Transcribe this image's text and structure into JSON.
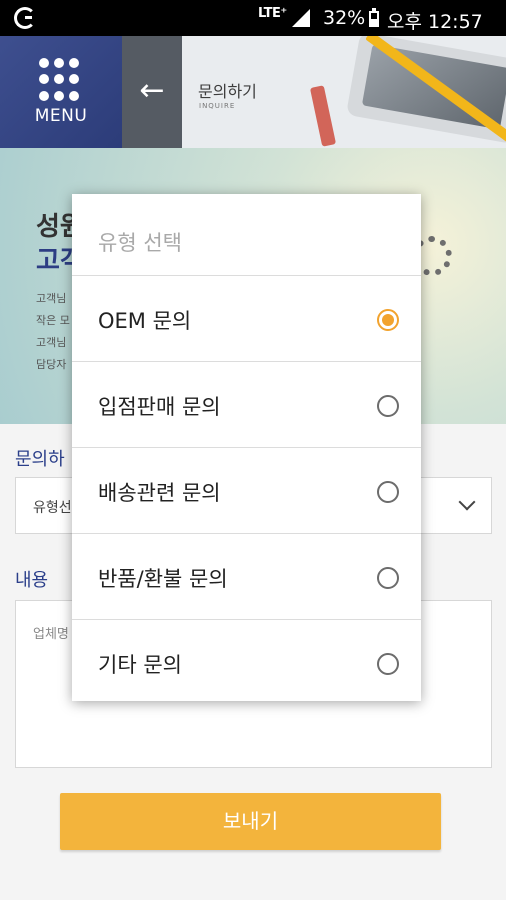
{
  "status_bar": {
    "network": "LTE⁺",
    "battery": "32%",
    "time": "오후 12:57"
  },
  "header": {
    "menu_label": "MENU",
    "back_icon": "arrow-left-icon",
    "title": "문의하기",
    "subtitle": "INQUIRE"
  },
  "banner": {
    "title_line1": "성원",
    "title_line2": "고객",
    "lines": [
      "고객님",
      "작은 모",
      "고객님",
      "담당자"
    ]
  },
  "form": {
    "type_label": "문의하",
    "type_value": "유형선",
    "content_label": "내용",
    "content_placeholder": "업체명",
    "submit_label": "보내기"
  },
  "dialog": {
    "title": "유형 선택",
    "options": [
      {
        "label": "OEM 문의",
        "selected": true
      },
      {
        "label": "입점판매 문의",
        "selected": false
      },
      {
        "label": "배송관련 문의",
        "selected": false
      },
      {
        "label": "반품/환불 문의",
        "selected": false
      },
      {
        "label": "기타 문의",
        "selected": false
      }
    ]
  },
  "colors": {
    "accent": "#f2a32e",
    "menu_blue": "#2c3c79",
    "submit": "#f3b43c"
  }
}
